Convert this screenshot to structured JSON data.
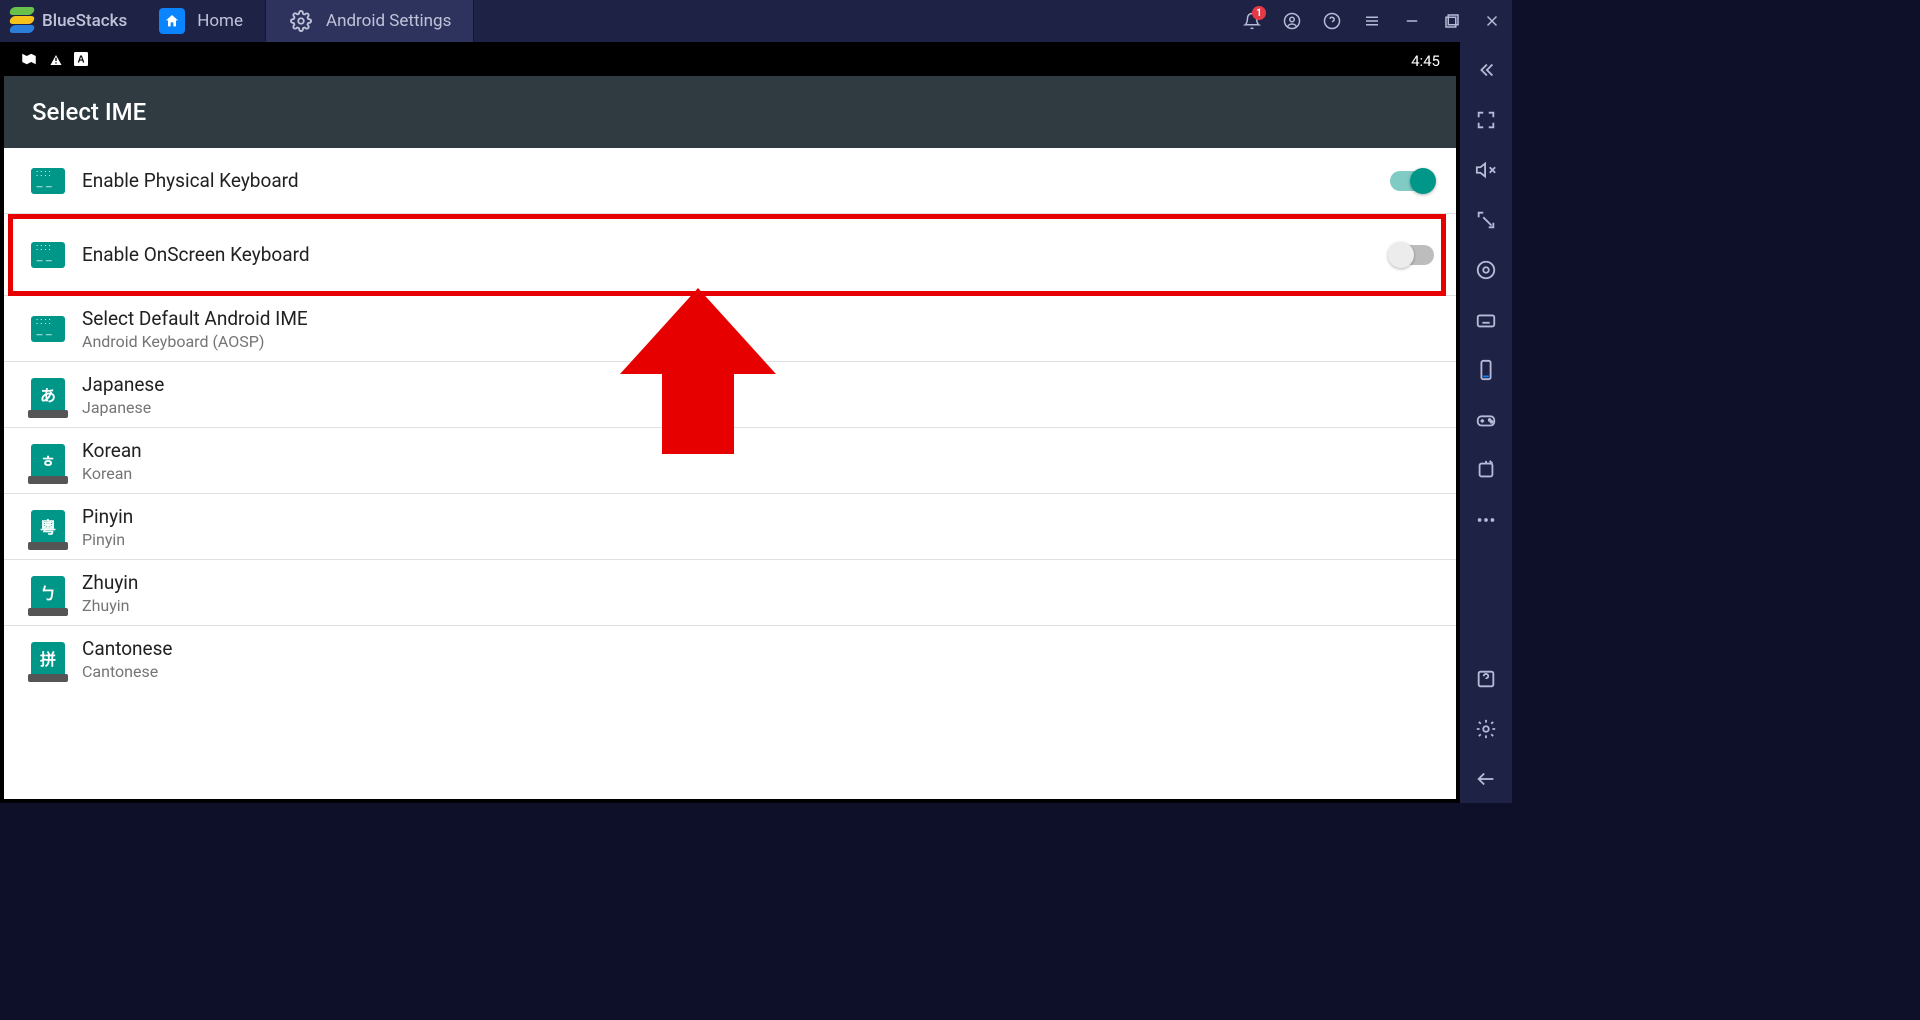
{
  "titlebar": {
    "app_name": "BlueStacks",
    "tabs": [
      {
        "label": "Home"
      },
      {
        "label": "Android Settings"
      }
    ],
    "notification_badge": "1"
  },
  "status_bar": {
    "time": "4:45"
  },
  "android": {
    "header_title": "Select IME",
    "rows": [
      {
        "title": "Enable Physical Keyboard",
        "sub": "",
        "icon": "kbd",
        "toggle": "on"
      },
      {
        "title": "Enable OnScreen Keyboard",
        "sub": "",
        "icon": "kbd",
        "toggle": "off"
      },
      {
        "title": "Select Default Android IME",
        "sub": "Android Keyboard (AOSP)",
        "icon": "kbd"
      },
      {
        "title": "Japanese",
        "sub": "Japanese",
        "icon": "lang",
        "glyph": "あ"
      },
      {
        "title": "Korean",
        "sub": "Korean",
        "icon": "lang",
        "glyph": "ㅎ"
      },
      {
        "title": "Pinyin",
        "sub": "Pinyin",
        "icon": "lang",
        "glyph": "粵"
      },
      {
        "title": "Zhuyin",
        "sub": "Zhuyin",
        "icon": "lang",
        "glyph": "ㄅ"
      },
      {
        "title": "Cantonese",
        "sub": "Cantonese",
        "icon": "lang",
        "glyph": "拼"
      }
    ]
  }
}
